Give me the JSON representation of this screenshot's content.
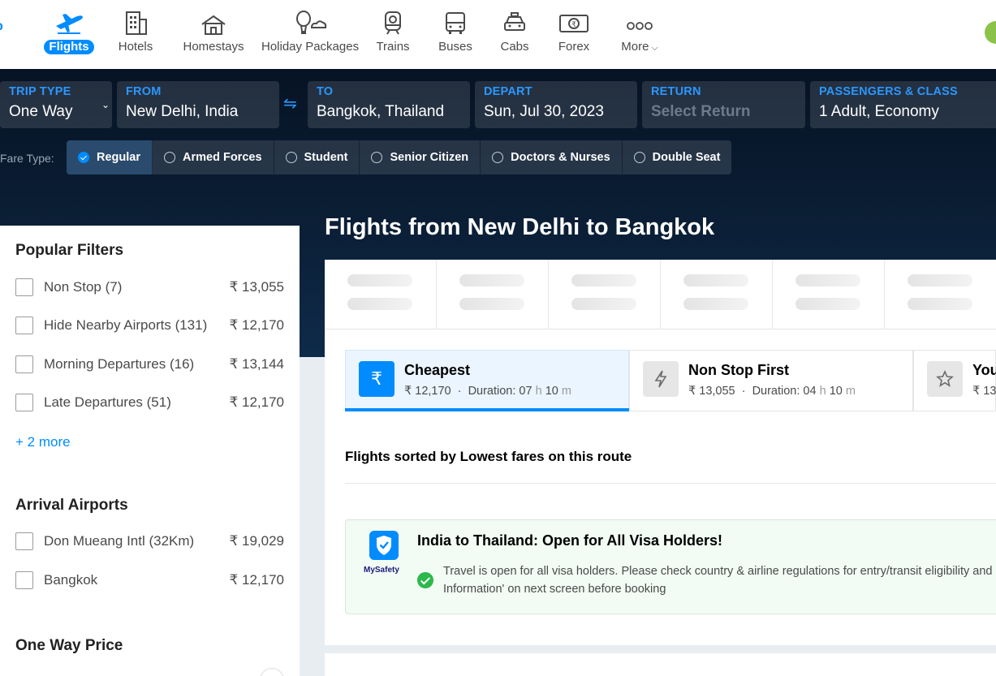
{
  "nav": {
    "items": [
      {
        "label": "Flights",
        "icon": "flight-icon",
        "active": true
      },
      {
        "label": "Hotels",
        "icon": "hotel-icon"
      },
      {
        "label": "Homestays",
        "icon": "homestay-icon"
      },
      {
        "label": "Holiday Packages",
        "icon": "holiday-packages-icon"
      },
      {
        "label": "Trains",
        "icon": "train-icon"
      },
      {
        "label": "Buses",
        "icon": "bus-icon"
      },
      {
        "label": "Cabs",
        "icon": "cab-icon"
      },
      {
        "label": "Forex",
        "icon": "forex-icon"
      },
      {
        "label": "More",
        "icon": "more-dots-icon"
      }
    ]
  },
  "search": {
    "trip_type": {
      "label": "TRIP TYPE",
      "value": "One Way"
    },
    "from": {
      "label": "FROM",
      "value": "New Delhi, India"
    },
    "to": {
      "label": "TO",
      "value": "Bangkok, Thailand"
    },
    "depart": {
      "label": "DEPART",
      "value": "Sun, Jul 30, 2023"
    },
    "return": {
      "label": "RETURN",
      "value": "Select Return"
    },
    "passengers": {
      "label": "PASSENGERS & CLASS",
      "value": "1 Adult, Economy"
    }
  },
  "fare": {
    "label": "Fare Type:",
    "options": [
      "Regular",
      "Armed Forces",
      "Student",
      "Senior Citizen",
      "Doctors & Nurses",
      "Double Seat"
    ],
    "selected": "Regular"
  },
  "filters": {
    "popular_title": "Popular Filters",
    "popular": [
      {
        "name": "Non Stop (7)",
        "price": "₹ 13,055"
      },
      {
        "name": "Hide Nearby Airports (131)",
        "price": "₹ 12,170"
      },
      {
        "name": "Morning Departures (16)",
        "price": "₹ 13,144"
      },
      {
        "name": "Late Departures (51)",
        "price": "₹ 12,170"
      }
    ],
    "more_link": "+ 2 more",
    "arrival_title": "Arrival Airports",
    "arrival": [
      {
        "name": "Don Mueang Intl (32Km)",
        "price": "₹ 19,029"
      },
      {
        "name": "Bangkok",
        "price": "₹ 12,170"
      }
    ],
    "price_title": "One Way Price"
  },
  "main": {
    "title": "Flights from New Delhi to Bangkok",
    "sort_tabs": [
      {
        "title": "Cheapest",
        "price": "₹ 12,170",
        "duration_prefix": "Duration: 07",
        "h": "h",
        "mins": "10",
        "m": "m",
        "icon": "rupee-icon"
      },
      {
        "title": "Non Stop First",
        "price": "₹ 13,055",
        "duration_prefix": "Duration: 04",
        "h": "h",
        "mins": "10",
        "m": "m",
        "icon": "lightning-icon"
      },
      {
        "title": "You",
        "price": "₹ 13",
        "icon": "star-icon"
      }
    ],
    "sorted_note": "Flights sorted by Lowest fares on this route",
    "safety": {
      "brand": "MySafety",
      "title": "India to Thailand: Open for All Visa Holders!",
      "line1": "Travel is open for all visa holders. Please check country & airline regulations for entry/transit eligibility and",
      "line2": "Information' on next screen before booking"
    }
  },
  "colors": {
    "accent": "#008cff",
    "hero_dark": "#061324",
    "success": "#2db84b"
  }
}
